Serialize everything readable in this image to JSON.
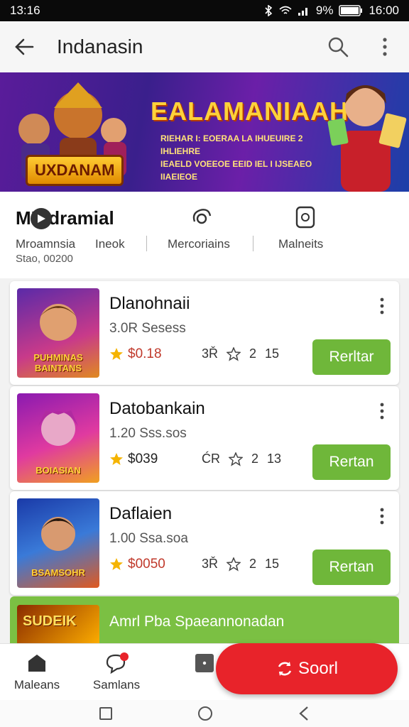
{
  "status_bar": {
    "time_left": "13:16",
    "battery": "9%",
    "time_right": "16:00"
  },
  "app_bar": {
    "title": "Indanasin"
  },
  "banner": {
    "headline": "EALAMANIAAH",
    "subtext_line1": "RIEHAR I: EOERAA LA IHUEUIRE 2 IHLIEHRE",
    "subtext_line2": "IEAELD VOEEOE EEID IEL I IJSEAEO IIAEIEOE",
    "logo_text": "UXDANAM"
  },
  "info": {
    "title": "MIEdramial",
    "stats": [
      "Mroamnsia",
      "Ineok",
      "Mercoriains",
      "Malneits"
    ],
    "sub": "Stao, 00200"
  },
  "items": [
    {
      "name": "Dlanohnaii",
      "meta": "3.0R Sesess",
      "price": "$0.18",
      "s1": "3Ř",
      "s2": "2",
      "s3": "15",
      "button": "Rerltar",
      "thumb_text": "PUHMINAS BAINTANS"
    },
    {
      "name": "Datobankain",
      "meta": "1.20 Sss.sos",
      "price": "$039",
      "s1": "ĆR",
      "s2": "2",
      "s3": "13",
      "button": "Rertan",
      "thumb_text": "BOIASIAN"
    },
    {
      "name": "Daflaien",
      "meta": "1.00 Ssa.soa",
      "price": "$0050",
      "s1": "3Ř",
      "s2": "2",
      "s3": "15",
      "button": "Rertan",
      "thumb_text": "BSAMSOHR"
    }
  ],
  "promo": {
    "text": "Amrl Pba Spaeannonadan",
    "thumb_text": "SUDEIK"
  },
  "bottom_nav": [
    {
      "label": "Maleans",
      "icon": "home-icon"
    },
    {
      "label": "Samlans",
      "icon": "chat-icon"
    },
    {
      "label": "",
      "icon": "square-icon"
    }
  ],
  "fab": {
    "label": "Soorl"
  },
  "colors": {
    "accent_green": "#6fb73a",
    "fab_red": "#e8232a",
    "price_red": "#c0392b",
    "star": "#f5b400"
  }
}
